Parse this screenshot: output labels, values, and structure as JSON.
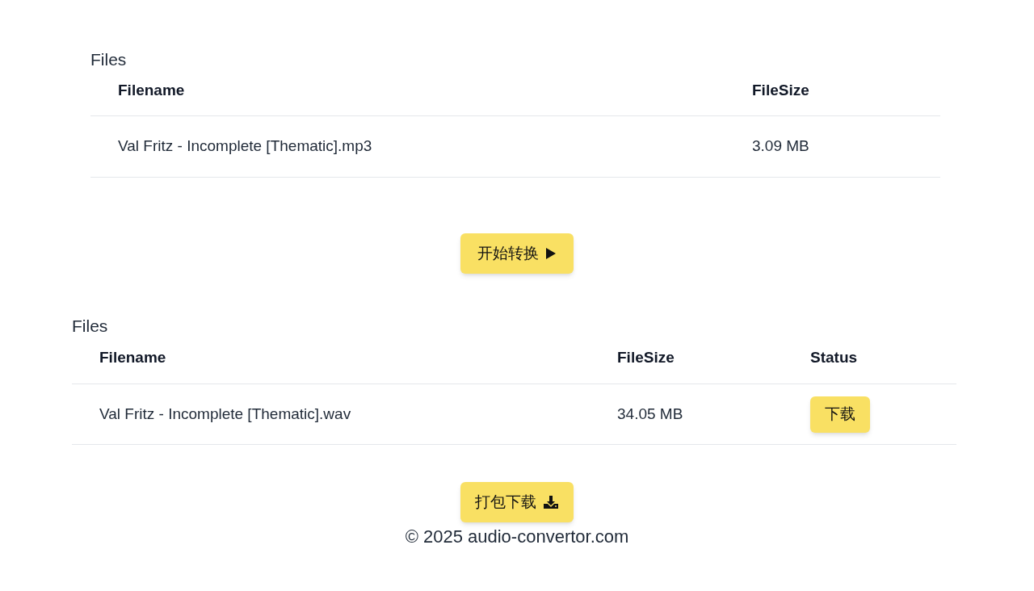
{
  "source_files": {
    "title": "Files",
    "columns": [
      "Filename",
      "FileSize"
    ],
    "rows": [
      {
        "filename": "Val Fritz - Incomplete [Thematic].mp3",
        "filesize": "3.09 MB"
      }
    ]
  },
  "convert_button": {
    "label": "开始转换"
  },
  "output_files": {
    "title": "Files",
    "columns": [
      "Filename",
      "FileSize",
      "Status"
    ],
    "rows": [
      {
        "filename": "Val Fritz - Incomplete [Thematic].wav",
        "filesize": "34.05 MB",
        "status_button": "下载"
      }
    ]
  },
  "download_all_button": {
    "label": "打包下载"
  },
  "footer": {
    "copyright": "© 2025 audio-convertor.com"
  }
}
